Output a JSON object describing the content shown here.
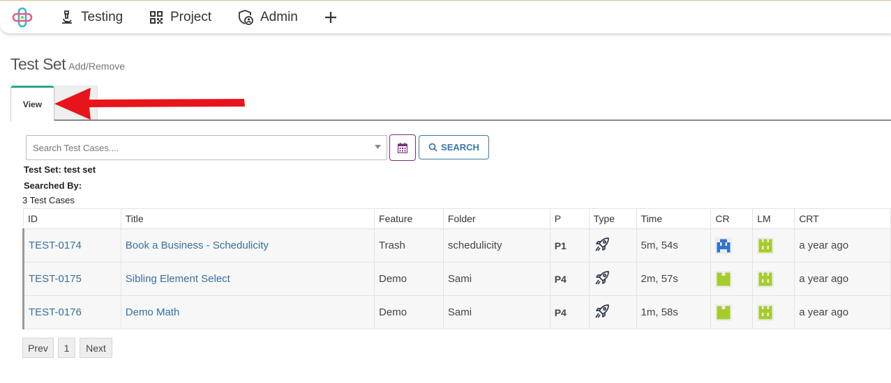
{
  "nav": {
    "items": [
      {
        "label": "Testing",
        "icon": "microscope-icon"
      },
      {
        "label": "Project",
        "icon": "qr-code-icon"
      },
      {
        "label": "Admin",
        "icon": "shield-user-icon"
      }
    ],
    "add_icon": "plus-icon"
  },
  "page": {
    "title": "Test Set",
    "subtitle": "Add/Remove"
  },
  "tabs": {
    "active": "View"
  },
  "search": {
    "placeholder": "Search Test Cases....",
    "button_label": "SEARCH"
  },
  "info": {
    "test_set": "Test Set: test set",
    "searched_by": "Searched By:",
    "count": "3 Test Cases"
  },
  "table": {
    "columns": [
      "ID",
      "Title",
      "Feature",
      "Folder",
      "P",
      "Type",
      "Time",
      "CR",
      "LM",
      "CRT"
    ],
    "rows": [
      {
        "id": "TEST-0174",
        "title": "Book a Business - Schedulicity",
        "feature": "Trash",
        "folder": "schedulicity",
        "priority": "P1",
        "type": "rocket-icon",
        "time": "5m, 54s",
        "cr": "blue-identicon-avatar",
        "lm": "green-identicon-avatar",
        "crt": "a year ago"
      },
      {
        "id": "TEST-0175",
        "title": "Sibling Element Select",
        "feature": "Demo",
        "folder": "Sami",
        "priority": "P4",
        "type": "rocket-icon",
        "time": "2m, 57s",
        "cr": "green-identicon-avatar",
        "lm": "green-identicon-avatar",
        "crt": "a year ago"
      },
      {
        "id": "TEST-0176",
        "title": "Demo Math",
        "feature": "Demo",
        "folder": "Sami",
        "priority": "P4",
        "type": "rocket-icon",
        "time": "1m, 58s",
        "cr": "green-identicon-avatar",
        "lm": "green-identicon-avatar",
        "crt": "a year ago"
      }
    ]
  },
  "pagination": {
    "prev": "Prev",
    "page": "1",
    "next": "Next"
  },
  "colors": {
    "accent_teal": "#27a38f",
    "link_blue": "#3a6f9c",
    "search_blue": "#3a79a8",
    "calendar_purple": "#7b2d7b",
    "annotation_red": "#e8141b",
    "avatar_blue": "#2f74d0",
    "avatar_green": "#a6cc2a"
  }
}
